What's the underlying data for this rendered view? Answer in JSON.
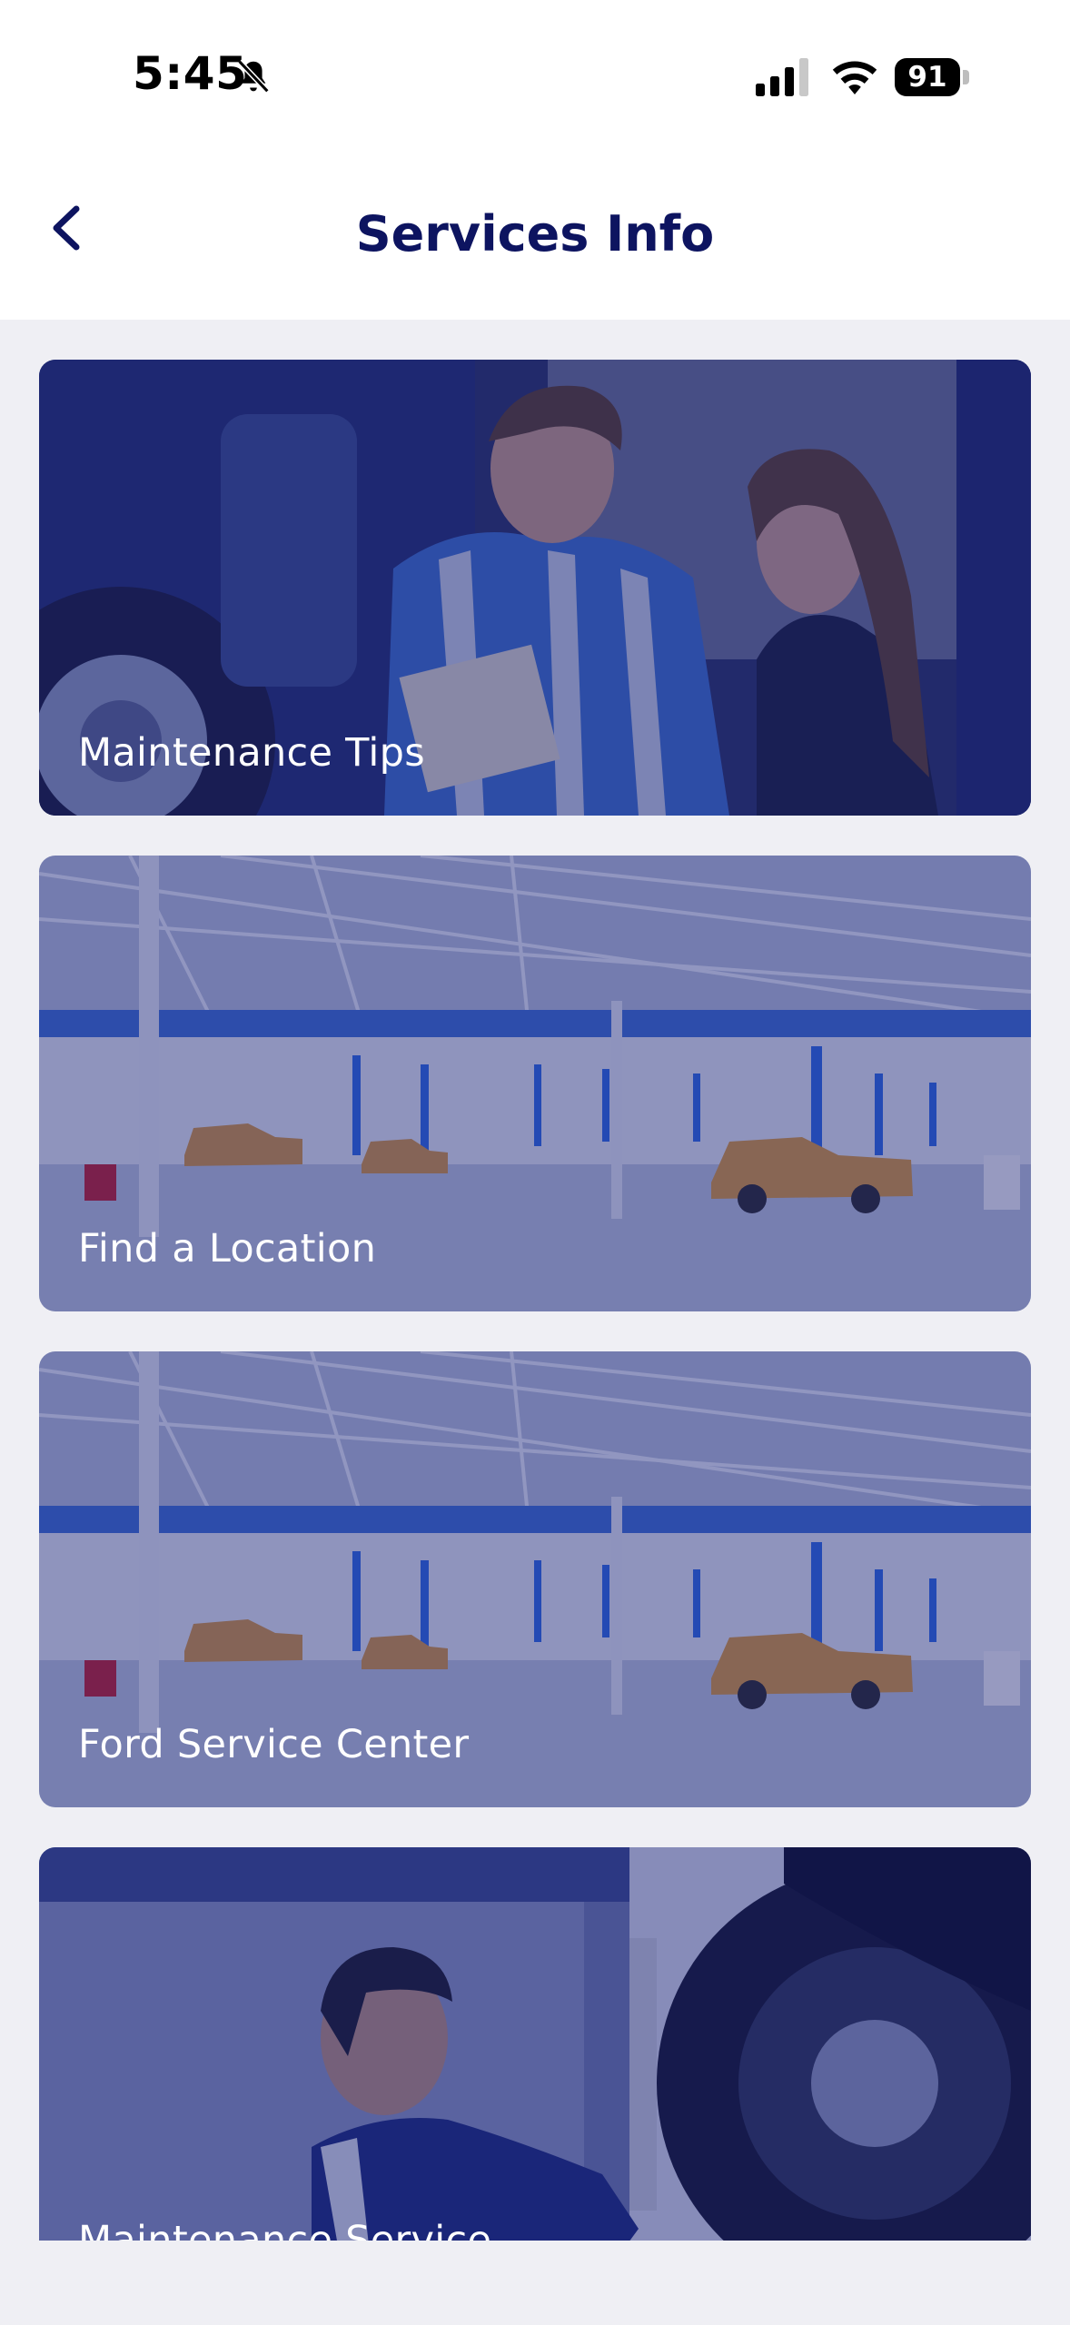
{
  "status_bar": {
    "time": "5:45",
    "battery": "91",
    "icons": [
      "bell-slash-icon",
      "cellular-signal-icon",
      "wifi-icon",
      "battery-icon"
    ]
  },
  "header": {
    "title": "Services Info",
    "back_icon": "chevron-left-icon"
  },
  "cards": [
    {
      "label": "Maintenance Tips",
      "image": "mechanic-with-customer-photo"
    },
    {
      "label": "Find a Location",
      "image": "service-garage-photo"
    },
    {
      "label": "Ford Service Center",
      "image": "service-garage-photo"
    },
    {
      "label": "Maintenance Service",
      "image": "wheel-alignment-mechanic-photo"
    }
  ],
  "colors": {
    "title": "#0d1460",
    "overlay": "#171e78",
    "background": "#efeff4"
  }
}
